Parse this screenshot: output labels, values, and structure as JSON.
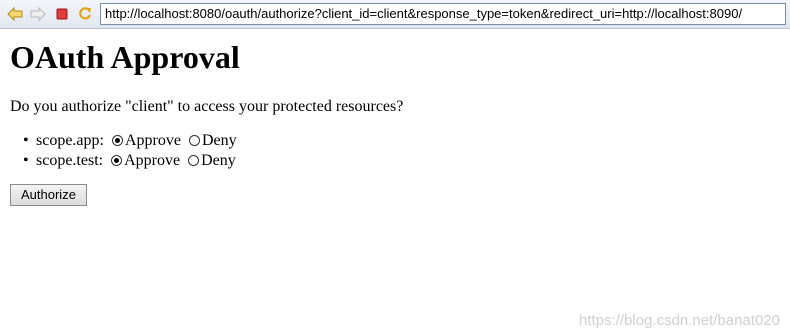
{
  "browser": {
    "url": "http://localhost:8080/oauth/authorize?client_id=client&response_type=token&redirect_uri=http://localhost:8090/",
    "icons": [
      "back-icon",
      "forward-icon",
      "stop-icon",
      "refresh-icon"
    ]
  },
  "page": {
    "title": "OAuth Approval",
    "question": "Do you authorize \"client\" to access your protected resources?",
    "scopes": [
      {
        "label": "scope.app:",
        "approve_label": "Approve",
        "deny_label": "Deny",
        "selected": "Approve"
      },
      {
        "label": "scope.test:",
        "approve_label": "Approve",
        "deny_label": "Deny",
        "selected": "Approve"
      }
    ],
    "authorize_label": "Authorize"
  },
  "watermark": "https://blog.csdn.net/banat020"
}
